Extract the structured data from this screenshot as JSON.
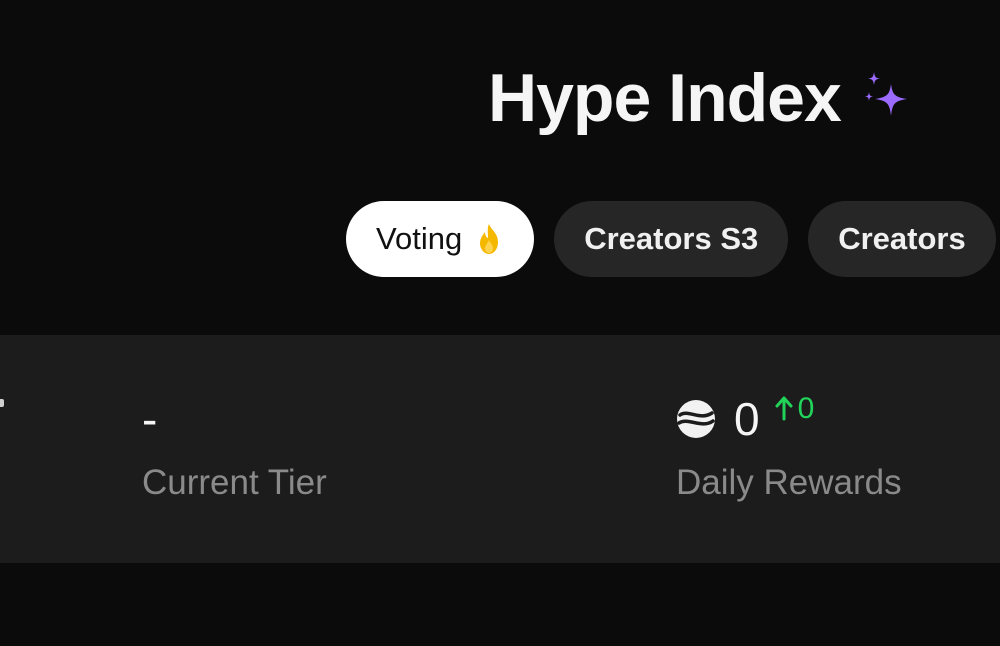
{
  "header": {
    "title": "Hype Index",
    "title_icon": "sparkles-icon",
    "accent_color": "#9b6bff"
  },
  "tabs": [
    {
      "label": "Voting",
      "icon": "fire-icon",
      "active": true
    },
    {
      "label": "Creators S3",
      "active": false
    },
    {
      "label": "Creators",
      "active": false
    }
  ],
  "stats": {
    "current_tier": {
      "value": "-",
      "label": "Current Tier"
    },
    "daily_rewards": {
      "icon": "coin-icon",
      "value": "0",
      "delta": "0",
      "delta_color": "#22d35a",
      "label": "Daily Rewards"
    }
  }
}
